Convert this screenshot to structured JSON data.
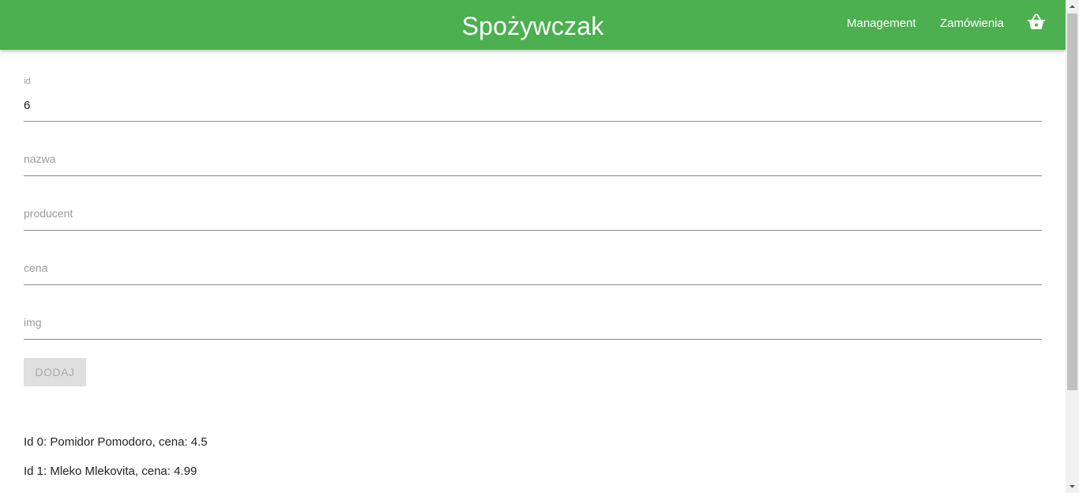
{
  "header": {
    "title": "Spożywczak",
    "nav": {
      "management": "Management",
      "orders": "Zamówienia"
    },
    "cart_icon": "shopping-basket-icon"
  },
  "form": {
    "id": {
      "label": "id",
      "value": "6"
    },
    "name": {
      "placeholder": "nazwa",
      "value": ""
    },
    "producer": {
      "placeholder": "producent",
      "value": ""
    },
    "price": {
      "placeholder": "cena",
      "value": ""
    },
    "img": {
      "placeholder": "img",
      "value": ""
    },
    "submit_label": "DODAJ",
    "submit_disabled": true
  },
  "products": [
    {
      "text": "Id 0: Pomidor Pomodoro, cena: 4.5"
    },
    {
      "text": "Id 1: Mleko Mlekovita, cena: 4.99"
    }
  ],
  "colors": {
    "appbar": "#4caf50",
    "button_disabled_bg": "#e0e0e0",
    "button_disabled_text": "#a8a8a8"
  }
}
